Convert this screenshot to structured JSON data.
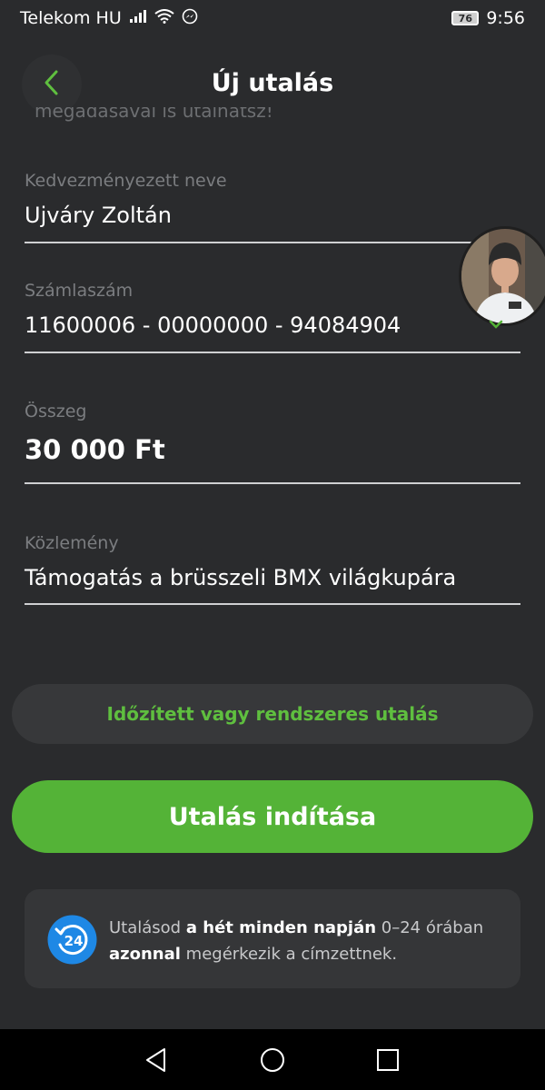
{
  "status_bar": {
    "carrier": "Telekom HU",
    "battery": "76",
    "time": "9:56"
  },
  "header": {
    "title": "Új utalás",
    "back_icon": "chevron-left-icon"
  },
  "clipped_hint": "megadásával is utalhatsz!",
  "form": {
    "beneficiary": {
      "label": "Kedvezményezett neve",
      "value": "Ujváry Zoltán"
    },
    "account": {
      "label": "Számlaszám",
      "value": "11600006 - 00000000 - 94084904"
    },
    "amount": {
      "label": "Összeg",
      "value": "30 000 Ft"
    },
    "message": {
      "label": "Közlemény",
      "value": "Támogatás a brüsszeli BMX világkupára"
    }
  },
  "buttons": {
    "scheduled": "Időzített vagy rendszeres utalás",
    "start": "Utalás indítása"
  },
  "info": {
    "icon_label": "24",
    "part1": "Utalásod ",
    "bold1": "a hét minden napján",
    "part2": " 0–24 órában ",
    "bold2": "azonnal",
    "part3": " megérkezik a címzettnek."
  },
  "colors": {
    "background": "#2a2b2d",
    "accent_green": "#54b337",
    "info_blue": "#1e88e5"
  }
}
